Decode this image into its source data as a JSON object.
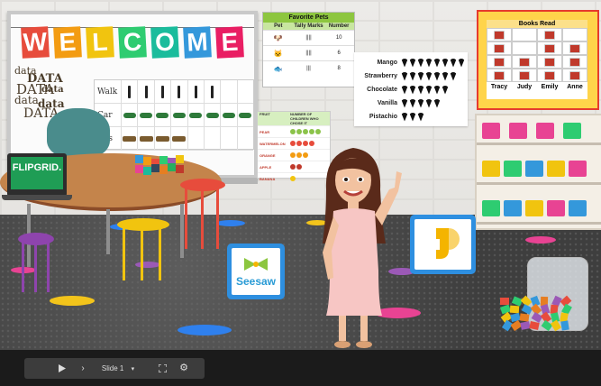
{
  "welcome": {
    "letters": [
      "W",
      "E",
      "L",
      "C",
      "O",
      "M",
      "E"
    ],
    "colors": [
      "#e74c3c",
      "#f39c12",
      "#f1c40f",
      "#2ecc71",
      "#1abc9c",
      "#3498db",
      "#e91e63"
    ]
  },
  "wordart": {
    "words": [
      "data",
      "DATA",
      "DATA",
      "data",
      "data",
      "data",
      "DATA"
    ]
  },
  "transport_chart": {
    "rows": [
      {
        "label": "Walk",
        "count": 6
      },
      {
        "label": "Car",
        "count": 8
      },
      {
        "label": "Bus",
        "count": 4
      }
    ]
  },
  "pets_chart": {
    "title": "Favorite Pets",
    "headers": [
      "Pet",
      "Tally Marks",
      "Number"
    ],
    "rows": [
      {
        "pet_icon": "dog-icon",
        "tally": "||||",
        "number": "10"
      },
      {
        "pet_icon": "cat-icon",
        "tally": "||||",
        "number": "6"
      },
      {
        "pet_icon": "fish-icon",
        "tally": "|||",
        "number": "8"
      }
    ]
  },
  "flavors_chart": {
    "rows": [
      {
        "flavor": "Mango",
        "count": 8
      },
      {
        "flavor": "Strawberry",
        "count": 7
      },
      {
        "flavor": "Chocolate",
        "count": 6
      },
      {
        "flavor": "Vanilla",
        "count": 5
      },
      {
        "flavor": "Pistachio",
        "count": 3
      }
    ]
  },
  "books_chart": {
    "title": "Books Read",
    "names": [
      "Tracy",
      "Judy",
      "Emily",
      "Anne"
    ],
    "counts": [
      4,
      2,
      4,
      3
    ]
  },
  "fruit_chart": {
    "header_left": "FRUIT",
    "header_right": "NUMBER OF CHILDREN WHO CHOSE IT",
    "rows": [
      "PEAR",
      "WATERMELON",
      "ORANGE",
      "APPLE",
      "BANANA"
    ]
  },
  "apps": {
    "laptop_label": "FLIPGRID.",
    "seesaw_label": "Seesaw"
  },
  "controls": {
    "play_icon": "play-icon",
    "next_icon": "next-icon",
    "slide_label": "Slide 1",
    "dropdown_icon": "chevron-down-icon",
    "fullscreen_icon": "fullscreen-icon",
    "settings_icon": "gear-icon"
  }
}
